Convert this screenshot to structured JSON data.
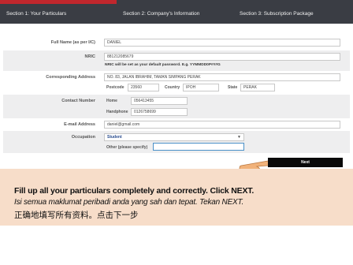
{
  "tabs": [
    {
      "label": "Section 1: Your Particulars"
    },
    {
      "label": "Section 2: Company's Information"
    },
    {
      "label": "Section 3: Subscription Package"
    }
  ],
  "form": {
    "full_name": {
      "label": "Full Name (as per I/C)",
      "value": "DANIEL"
    },
    "nric": {
      "label": "NRIC",
      "value": "881212085679",
      "note": "NRIC will be set as your default password. E.g. YYMMDD0P###G"
    },
    "address": {
      "label": "Corresponding Address",
      "value": "NO. 83, JALAN IBRAHIM, TAMAN SIMPANG PERAK",
      "postcode_label": "Postcode",
      "postcode": "23560",
      "country_label": "Country",
      "country": "IPOH",
      "state_label": "State",
      "state": "PERAK"
    },
    "contact": {
      "label": "Contact Number",
      "home_label": "Home",
      "home": "056413455",
      "handphone_label": "Handphone",
      "handphone": "0126758699"
    },
    "email": {
      "label": "E-mail Address",
      "value": "daniel@gmail.com"
    },
    "occupation": {
      "label": "Occupation",
      "selected": "Student",
      "other_label": "Other (please specify)",
      "other_value": ""
    }
  },
  "next_label": "Next",
  "caption": {
    "line1": "Fill up all your particulars completely and correctly. Click NEXT.",
    "line2": "Isi semua maklumat peribadi anda yang sah dan tepat. Tekan NEXT.",
    "line3": "正确地填写所有资料。点击下一步"
  },
  "colors": {
    "topbar": "#3a3d44",
    "accent": "#c0272d",
    "caption_bg": "#f7ddc9",
    "button": "#0a0a0a"
  },
  "icons": {
    "pointer": "pointing-hand-icon"
  }
}
